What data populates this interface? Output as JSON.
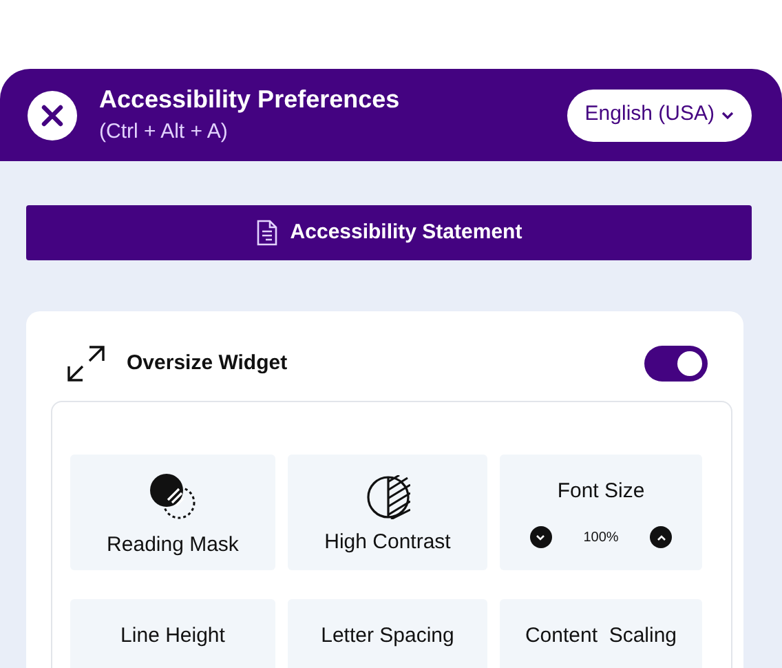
{
  "header": {
    "title": "Accessibility Preferences",
    "shortcut": "(Ctrl + Alt + A)",
    "language": "English (USA)"
  },
  "statement_button": "Accessibility Statement",
  "oversize_widget": {
    "label": "Oversize Widget",
    "on": true
  },
  "tiles": [
    {
      "kind": "mask",
      "label": "Reading Mask"
    },
    {
      "kind": "contrast",
      "label": "High Contrast"
    },
    {
      "kind": "stepper",
      "label": "Font Size",
      "value": "100%"
    },
    {
      "kind": "label",
      "label": "Line Height"
    },
    {
      "kind": "label",
      "label": "Letter Spacing"
    },
    {
      "kind": "label",
      "label": "Content  Scaling"
    }
  ]
}
